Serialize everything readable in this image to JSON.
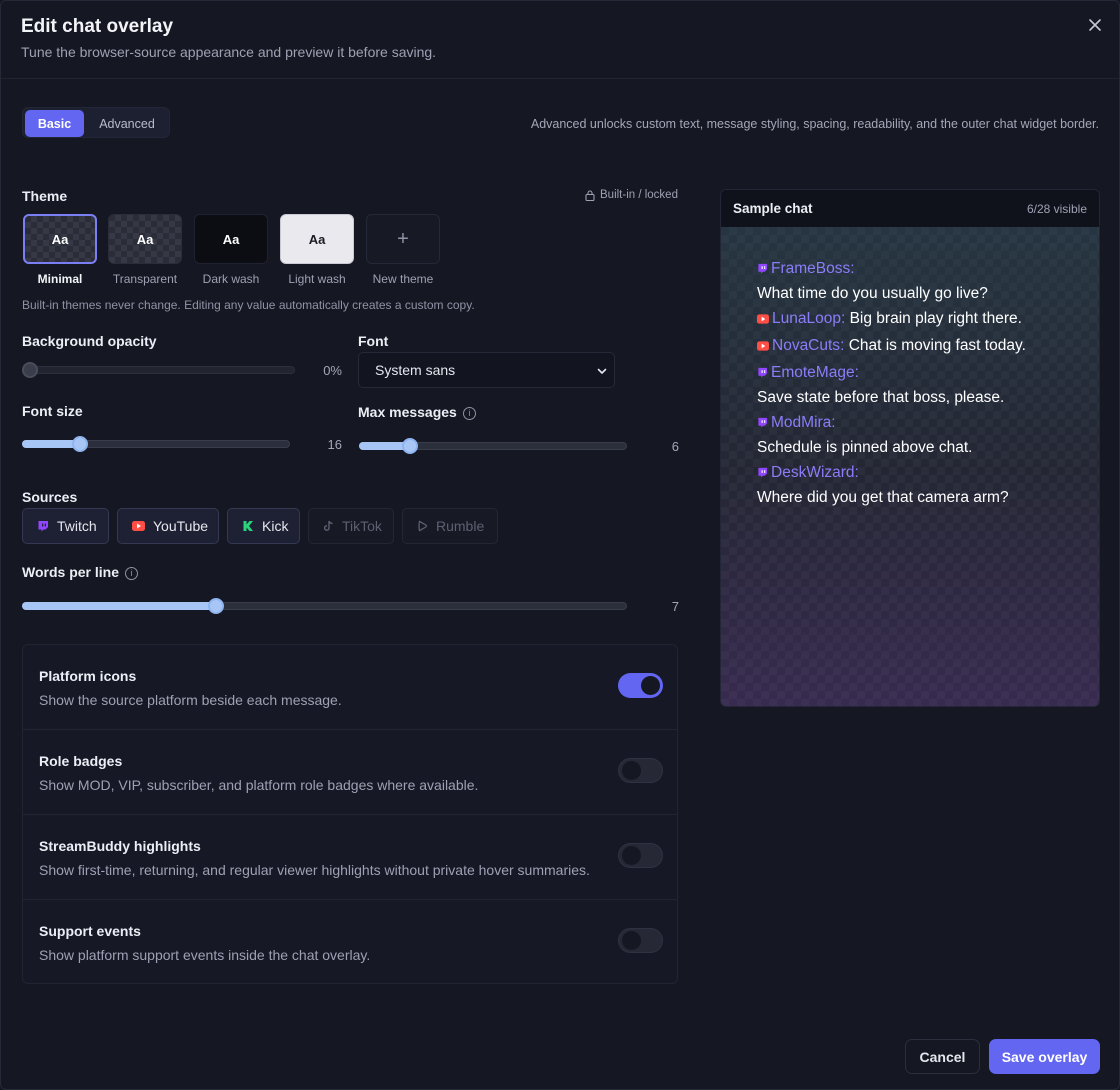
{
  "header": {
    "title": "Edit chat overlay",
    "subtitle": "Tune the browser-source appearance and preview it before saving.",
    "close_icon": "close-icon"
  },
  "mode_tabs": {
    "basic": "Basic",
    "advanced": "Advanced",
    "selected": "Basic",
    "hint": "Advanced unlocks custom text, message styling, spacing, readability, and the outer chat widget border."
  },
  "theme": {
    "label": "Theme",
    "locked_label": "Built-in / locked",
    "selected": "Minimal",
    "cards": [
      {
        "name": "Minimal",
        "sample": "Aa"
      },
      {
        "name": "Transparent",
        "sample": "Aa"
      },
      {
        "name": "Dark wash",
        "sample": "Aa"
      },
      {
        "name": "Light wash",
        "sample": "Aa"
      },
      {
        "name": "New theme",
        "sample": "+"
      }
    ],
    "hint": "Built-in themes never change. Editing any value automatically creates a custom copy."
  },
  "background_opacity": {
    "label": "Background opacity",
    "value": 0,
    "display": "0%"
  },
  "font": {
    "label": "Font",
    "value": "System sans"
  },
  "font_size": {
    "label": "Font size",
    "value": 16,
    "min": 8,
    "max": 48,
    "display": "16"
  },
  "max_messages": {
    "label": "Max messages",
    "value": 6,
    "min": 1,
    "max": 30,
    "display": "6"
  },
  "sources": {
    "label": "Sources",
    "items": [
      {
        "name": "Twitch",
        "enabled": true,
        "color": "#9146ff"
      },
      {
        "name": "YouTube",
        "enabled": true,
        "color": "#ff4e45"
      },
      {
        "name": "Kick",
        "enabled": true,
        "color": "#53fc18"
      },
      {
        "name": "TikTok",
        "enabled": false,
        "color": "#5d6072"
      },
      {
        "name": "Rumble",
        "enabled": false,
        "color": "#5d6072"
      }
    ]
  },
  "words_per_line": {
    "label": "Words per line",
    "value": 7,
    "min": 1,
    "max": 20,
    "display": "7"
  },
  "toggles": [
    {
      "title": "Platform icons",
      "description": "Show the source platform beside each message.",
      "on": true
    },
    {
      "title": "Role badges",
      "description": "Show MOD, VIP, subscriber, and platform role badges where available.",
      "on": false
    },
    {
      "title": "StreamBuddy highlights",
      "description": "Show first-time, returning, and regular viewer highlights without private hover summaries.",
      "on": false
    },
    {
      "title": "Support events",
      "description": "Show platform support events inside the chat overlay.",
      "on": false
    }
  ],
  "preview": {
    "title": "Sample chat",
    "count": "6/28 visible",
    "messages": [
      {
        "platform": "twitch",
        "name": "FrameBoss",
        "text": "What time do you usually go live?"
      },
      {
        "platform": "youtube",
        "name": "LunaLoop",
        "text": "Big brain play right there."
      },
      {
        "platform": "youtube",
        "name": "NovaCuts",
        "text": "Chat is moving fast today."
      },
      {
        "platform": "twitch",
        "name": "EmoteMage",
        "text": "Save state before that boss, please."
      },
      {
        "platform": "twitch",
        "name": "ModMira",
        "text": "Schedule is pinned above chat."
      },
      {
        "platform": "twitch",
        "name": "DeskWizard",
        "text": "Where did you get that camera arm?"
      }
    ]
  },
  "footer": {
    "cancel": "Cancel",
    "save": "Save overlay"
  },
  "colors": {
    "accent": "#6366f1",
    "slider": "#a8c6f5",
    "username": "#8b7cf8",
    "background": "#151722"
  }
}
